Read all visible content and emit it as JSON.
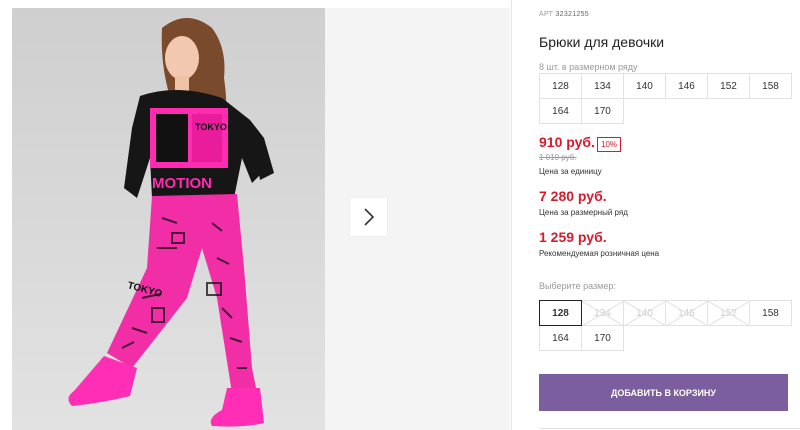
{
  "gallery": {
    "image_alt": "Девочка в черном свитшоте и розовых брюках с принтом",
    "shirt_print": "TOKYO",
    "shirt_slogan": "MOTION",
    "pants_print": "TOKYO",
    "next_icon": "chevron-right-icon"
  },
  "product": {
    "sku_label": "АРТ",
    "sku": "32321255",
    "title": "Брюки для девочки",
    "set_note": "8 шт. в размерном ряду",
    "set_sizes": [
      "128",
      "134",
      "140",
      "146",
      "152",
      "158",
      "164",
      "170"
    ],
    "price": "910 руб.",
    "discount": "10%",
    "old_price": "1 010 руб.",
    "price_caption": "Цена за единицу",
    "set_price": "7 280 руб.",
    "set_price_caption": "Цена за размерный ряд",
    "retail_price": "1 259 руб.",
    "retail_caption": "Рекомендуемая розничная цена",
    "choose_size_label": "Выберите размер:",
    "sizes": [
      {
        "label": "128",
        "state": "selected"
      },
      {
        "label": "134",
        "state": "unavailable"
      },
      {
        "label": "140",
        "state": "unavailable"
      },
      {
        "label": "146",
        "state": "unavailable"
      },
      {
        "label": "152",
        "state": "unavailable"
      },
      {
        "label": "158",
        "state": "available"
      },
      {
        "label": "164",
        "state": "available"
      },
      {
        "label": "170",
        "state": "available"
      }
    ],
    "add_to_cart": "ДОБАВИТЬ В КОРЗИНУ"
  },
  "colors": {
    "price_red": "#d41c2d",
    "button_purple": "#7b5e9e",
    "pants_pink": "#f22ea7"
  }
}
